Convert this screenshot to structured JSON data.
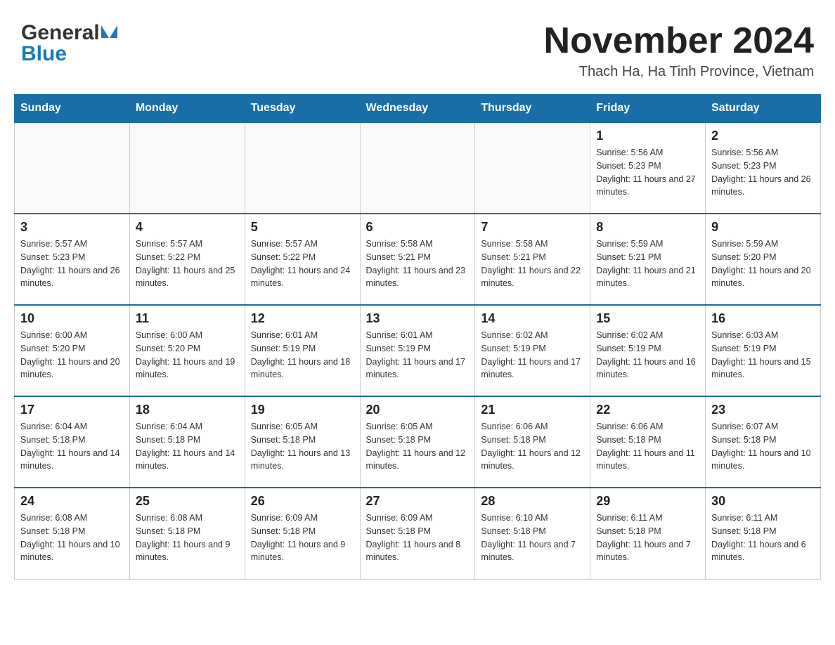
{
  "logo": {
    "general": "General",
    "blue": "Blue"
  },
  "header": {
    "month_year": "November 2024",
    "location": "Thach Ha, Ha Tinh Province, Vietnam"
  },
  "days_of_week": [
    "Sunday",
    "Monday",
    "Tuesday",
    "Wednesday",
    "Thursday",
    "Friday",
    "Saturday"
  ],
  "weeks": [
    [
      {
        "day": "",
        "info": ""
      },
      {
        "day": "",
        "info": ""
      },
      {
        "day": "",
        "info": ""
      },
      {
        "day": "",
        "info": ""
      },
      {
        "day": "",
        "info": ""
      },
      {
        "day": "1",
        "info": "Sunrise: 5:56 AM\nSunset: 5:23 PM\nDaylight: 11 hours and 27 minutes."
      },
      {
        "day": "2",
        "info": "Sunrise: 5:56 AM\nSunset: 5:23 PM\nDaylight: 11 hours and 26 minutes."
      }
    ],
    [
      {
        "day": "3",
        "info": "Sunrise: 5:57 AM\nSunset: 5:23 PM\nDaylight: 11 hours and 26 minutes."
      },
      {
        "day": "4",
        "info": "Sunrise: 5:57 AM\nSunset: 5:22 PM\nDaylight: 11 hours and 25 minutes."
      },
      {
        "day": "5",
        "info": "Sunrise: 5:57 AM\nSunset: 5:22 PM\nDaylight: 11 hours and 24 minutes."
      },
      {
        "day": "6",
        "info": "Sunrise: 5:58 AM\nSunset: 5:21 PM\nDaylight: 11 hours and 23 minutes."
      },
      {
        "day": "7",
        "info": "Sunrise: 5:58 AM\nSunset: 5:21 PM\nDaylight: 11 hours and 22 minutes."
      },
      {
        "day": "8",
        "info": "Sunrise: 5:59 AM\nSunset: 5:21 PM\nDaylight: 11 hours and 21 minutes."
      },
      {
        "day": "9",
        "info": "Sunrise: 5:59 AM\nSunset: 5:20 PM\nDaylight: 11 hours and 20 minutes."
      }
    ],
    [
      {
        "day": "10",
        "info": "Sunrise: 6:00 AM\nSunset: 5:20 PM\nDaylight: 11 hours and 20 minutes."
      },
      {
        "day": "11",
        "info": "Sunrise: 6:00 AM\nSunset: 5:20 PM\nDaylight: 11 hours and 19 minutes."
      },
      {
        "day": "12",
        "info": "Sunrise: 6:01 AM\nSunset: 5:19 PM\nDaylight: 11 hours and 18 minutes."
      },
      {
        "day": "13",
        "info": "Sunrise: 6:01 AM\nSunset: 5:19 PM\nDaylight: 11 hours and 17 minutes."
      },
      {
        "day": "14",
        "info": "Sunrise: 6:02 AM\nSunset: 5:19 PM\nDaylight: 11 hours and 17 minutes."
      },
      {
        "day": "15",
        "info": "Sunrise: 6:02 AM\nSunset: 5:19 PM\nDaylight: 11 hours and 16 minutes."
      },
      {
        "day": "16",
        "info": "Sunrise: 6:03 AM\nSunset: 5:19 PM\nDaylight: 11 hours and 15 minutes."
      }
    ],
    [
      {
        "day": "17",
        "info": "Sunrise: 6:04 AM\nSunset: 5:18 PM\nDaylight: 11 hours and 14 minutes."
      },
      {
        "day": "18",
        "info": "Sunrise: 6:04 AM\nSunset: 5:18 PM\nDaylight: 11 hours and 14 minutes."
      },
      {
        "day": "19",
        "info": "Sunrise: 6:05 AM\nSunset: 5:18 PM\nDaylight: 11 hours and 13 minutes."
      },
      {
        "day": "20",
        "info": "Sunrise: 6:05 AM\nSunset: 5:18 PM\nDaylight: 11 hours and 12 minutes."
      },
      {
        "day": "21",
        "info": "Sunrise: 6:06 AM\nSunset: 5:18 PM\nDaylight: 11 hours and 12 minutes."
      },
      {
        "day": "22",
        "info": "Sunrise: 6:06 AM\nSunset: 5:18 PM\nDaylight: 11 hours and 11 minutes."
      },
      {
        "day": "23",
        "info": "Sunrise: 6:07 AM\nSunset: 5:18 PM\nDaylight: 11 hours and 10 minutes."
      }
    ],
    [
      {
        "day": "24",
        "info": "Sunrise: 6:08 AM\nSunset: 5:18 PM\nDaylight: 11 hours and 10 minutes."
      },
      {
        "day": "25",
        "info": "Sunrise: 6:08 AM\nSunset: 5:18 PM\nDaylight: 11 hours and 9 minutes."
      },
      {
        "day": "26",
        "info": "Sunrise: 6:09 AM\nSunset: 5:18 PM\nDaylight: 11 hours and 9 minutes."
      },
      {
        "day": "27",
        "info": "Sunrise: 6:09 AM\nSunset: 5:18 PM\nDaylight: 11 hours and 8 minutes."
      },
      {
        "day": "28",
        "info": "Sunrise: 6:10 AM\nSunset: 5:18 PM\nDaylight: 11 hours and 7 minutes."
      },
      {
        "day": "29",
        "info": "Sunrise: 6:11 AM\nSunset: 5:18 PM\nDaylight: 11 hours and 7 minutes."
      },
      {
        "day": "30",
        "info": "Sunrise: 6:11 AM\nSunset: 5:18 PM\nDaylight: 11 hours and 6 minutes."
      }
    ]
  ]
}
